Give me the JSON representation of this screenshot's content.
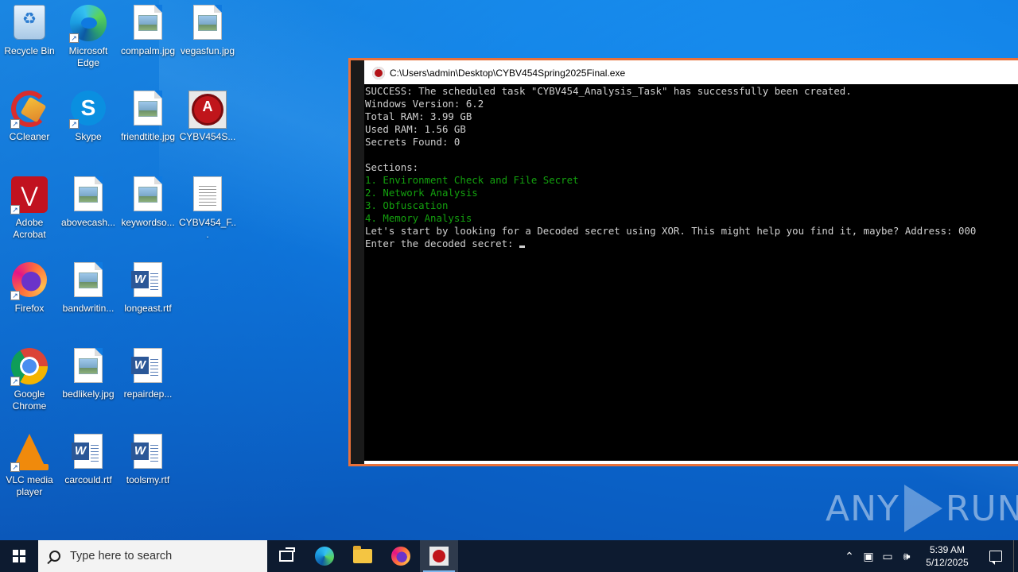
{
  "desktop": {
    "icons": [
      {
        "label": "Recycle Bin",
        "icon": "recycle-bin-icon"
      },
      {
        "label": "Microsoft Edge",
        "icon": "edge-icon"
      },
      {
        "label": "compalm.jpg",
        "icon": "image-file-icon"
      },
      {
        "label": "vegasfun.jpg",
        "icon": "image-file-icon"
      },
      {
        "label": "CCleaner",
        "icon": "ccleaner-icon"
      },
      {
        "label": "Skype",
        "icon": "skype-icon"
      },
      {
        "label": "friendtitle.jpg",
        "icon": "image-file-icon"
      },
      {
        "label": "CYBV454S...",
        "icon": "malware-app-icon"
      },
      {
        "label": "Adobe Acrobat",
        "icon": "acrobat-icon"
      },
      {
        "label": "abovecash...",
        "icon": "image-file-icon"
      },
      {
        "label": "keywordso...",
        "icon": "image-file-icon"
      },
      {
        "label": "CYBV454_F...",
        "icon": "text-file-icon"
      },
      {
        "label": "Firefox",
        "icon": "firefox-icon"
      },
      {
        "label": "bandwritin...",
        "icon": "image-file-icon"
      },
      {
        "label": "longeast.rtf",
        "icon": "word-file-icon"
      },
      {
        "label": "Google Chrome",
        "icon": "chrome-icon"
      },
      {
        "label": "bedlikely.jpg",
        "icon": "image-file-icon"
      },
      {
        "label": "repairdep...",
        "icon": "word-file-icon"
      },
      {
        "label": "VLC media player",
        "icon": "vlc-icon"
      },
      {
        "label": "carcould.rtf",
        "icon": "word-file-icon"
      },
      {
        "label": "toolsmy.rtf",
        "icon": "word-file-icon"
      }
    ]
  },
  "console": {
    "title": "C:\\Users\\admin\\Desktop\\CYBV454Spring2025Final.exe",
    "lines": [
      {
        "text": "SUCCESS: The scheduled task \"CYBV454_Analysis_Task\" has successfully been created.",
        "color": "#d0d0d0"
      },
      {
        "text": "Windows Version: 6.2",
        "color": "#d0d0d0"
      },
      {
        "text": "Total RAM: 3.99 GB",
        "color": "#d0d0d0"
      },
      {
        "text": "Used RAM: 1.56 GB",
        "color": "#d0d0d0"
      },
      {
        "text": "Secrets Found: 0",
        "color": "#d0d0d0"
      },
      {
        "text": "",
        "color": "#d0d0d0"
      },
      {
        "text": "Sections:",
        "color": "#d0d0d0"
      },
      {
        "text": "1. Environment Check and File Secret",
        "color": "#13a10e"
      },
      {
        "text": "2. Network Analysis",
        "color": "#13a10e"
      },
      {
        "text": "3. Obfuscation",
        "color": "#13a10e"
      },
      {
        "text": "4. Memory Analysis",
        "color": "#13a10e"
      },
      {
        "text": "Let's start by looking for a Decoded secret using XOR. This might help you find it, maybe? Address: 000",
        "color": "#d0d0d0"
      }
    ],
    "prompt": "Enter the decoded secret: "
  },
  "watermark": {
    "left": "ANY",
    "right": "RUN"
  },
  "taskbar": {
    "search_placeholder": "Type here to search",
    "apps": [
      "task-view",
      "edge",
      "file-explorer",
      "firefox",
      "cybv454-final"
    ],
    "clock_time": "5:39 AM",
    "clock_date": "5/12/2025"
  },
  "colors": {
    "accent_frame": "#e9713a",
    "console_green": "#13a10e",
    "taskbar_bg": "#0d1b30"
  }
}
